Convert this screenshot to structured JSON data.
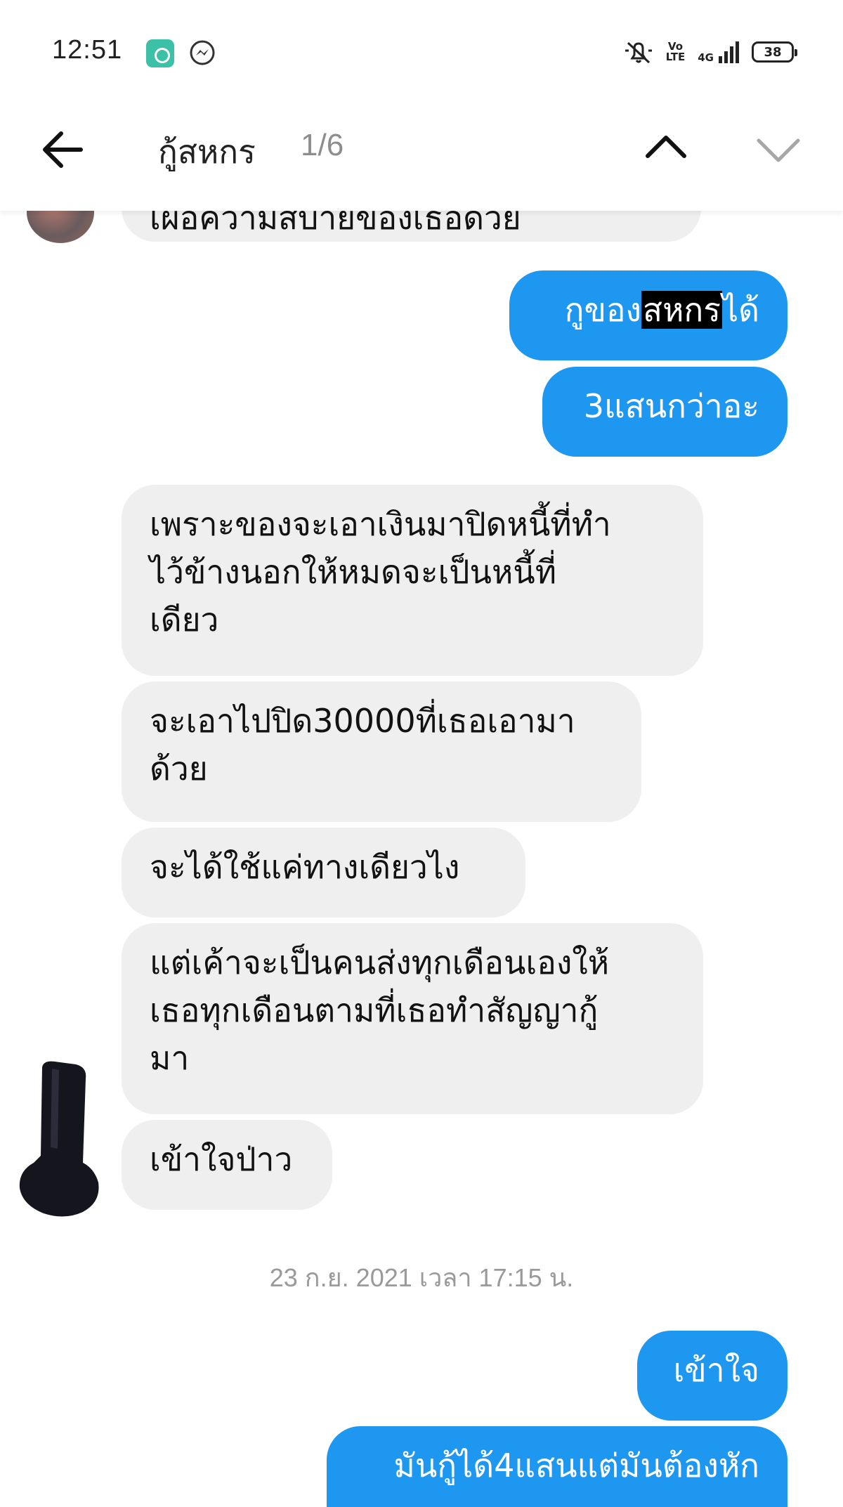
{
  "status_bar": {
    "time": "12:51",
    "battery": "38",
    "volte_top": "Vo",
    "volte_bottom": "LTE",
    "network": "4G"
  },
  "search_header": {
    "query": "กู้สหกร",
    "result_count": "1/6"
  },
  "messages": {
    "top_partial": "เผื่อความสบายของเธอด้วย",
    "out1": {
      "prefix": "กูของ",
      "highlight": "สหกร",
      "suffix": "ได้"
    },
    "out2": "3แสนกว่าอะ",
    "in1": [
      "เพราะของจะเอาเงินมาปิดหนี้ที่ทำ",
      "ไว้ข้างนอกให้หมดจะเป็นหนี้ที่",
      "เดียว"
    ],
    "in2": [
      "จะเอาไปปิด30000ที่เธอเอามา",
      "ด้วย"
    ],
    "in3": "จะได้ใช้แค่ทางเดียวไง",
    "in4": [
      "แต่เค้าจะเป็นคนส่งทุกเดือนเองให้",
      "เธอทุกเดือนตามที่เธอทำสัญญากู้",
      "มา"
    ],
    "in5": "เข้าใจป่าว",
    "timestamp": "23 ก.ย. 2021 เวลา 17:15 น.",
    "out3": "เข้าใจ",
    "out4": "มันกู้ได้4แสนแต่มันต้องหัก"
  },
  "colors": {
    "outgoing_bubble": "#1e97f0",
    "incoming_bubble": "#efefef",
    "highlight": "#000000"
  }
}
